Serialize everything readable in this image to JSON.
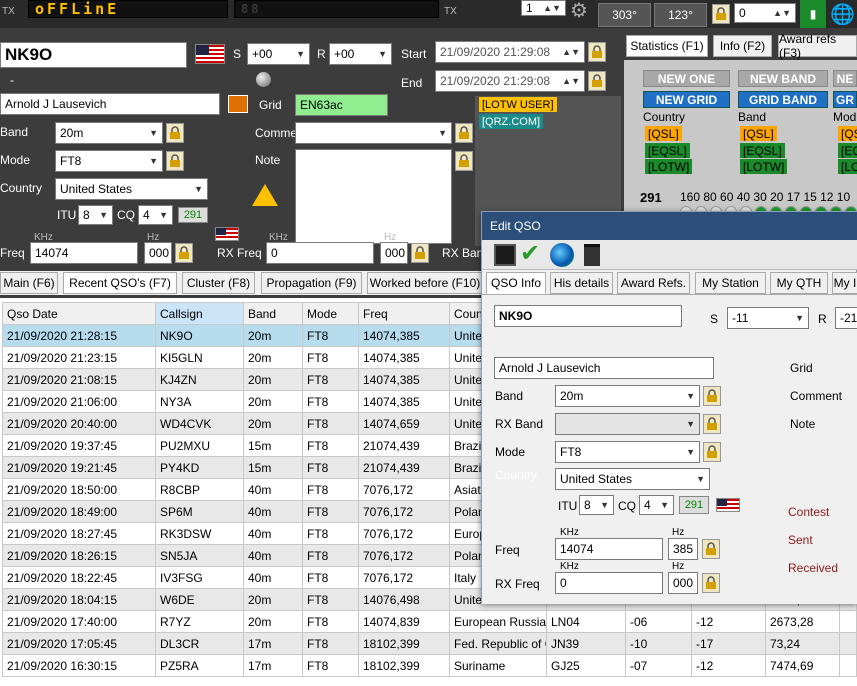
{
  "top": {
    "tx_label": "TX",
    "tx_label2": "TX",
    "lcd_dim": "88",
    "lcd_text": "oFFLinE",
    "spin_value": "1",
    "az_left": "303°",
    "az_right": "123°",
    "lock_input": "0"
  },
  "main": {
    "callsign": "NK9O",
    "s_label": "S",
    "s_value": "+00",
    "r_label": "R",
    "r_value": "+00",
    "start_label": "Start",
    "start_value": "21/09/2020 21:29:08",
    "end_label": "End",
    "end_value": "21/09/2020 21:29:08",
    "dash": "-",
    "name": "Arnold J Lausevich",
    "grid_label": "Grid",
    "grid_value": "EN63ac",
    "band_label": "Band",
    "band_value": "20m",
    "mode_label": "Mode",
    "mode_value": "FT8",
    "country_label": "Country",
    "country_value": "United States",
    "itu_label": "ITU",
    "itu_value": "8",
    "cq_label": "CQ",
    "cq_value": "4",
    "dxcc_value": "291",
    "comment_label": "Comment",
    "note_label": "Note",
    "lotw_user": "[LOTW USER]",
    "qrz": "[QRZ.COM]",
    "freq_label": "Freq",
    "khz": "KHz",
    "hz": "Hz",
    "freq_value": "14074",
    "hz_value": "000",
    "rx_freq_label": "RX Freq",
    "rx_freq_value": "0",
    "rx_hz_value": "000",
    "rx_band_label": "RX Ban"
  },
  "tabs": [
    "Main (F6)",
    "Recent QSO's (F7)",
    "Cluster (F8)",
    "Propagation (F9)",
    "Worked before (F10)"
  ],
  "table": {
    "headers": [
      "Qso Date",
      "Callsign",
      "Band",
      "Mode",
      "Freq",
      "Country"
    ],
    "rows": [
      [
        "21/09/2020 21:28:15",
        "NK9O",
        "20m",
        "FT8",
        "14074,385",
        "United States"
      ],
      [
        "21/09/2020 21:23:15",
        "KI5GLN",
        "20m",
        "FT8",
        "14074,385",
        "United States"
      ],
      [
        "21/09/2020 21:08:15",
        "KJ4ZN",
        "20m",
        "FT8",
        "14074,385",
        "United States"
      ],
      [
        "21/09/2020 21:06:00",
        "NY3A",
        "20m",
        "FT8",
        "14074,385",
        "United States"
      ],
      [
        "21/09/2020 20:40:00",
        "WD4CVK",
        "20m",
        "FT8",
        "14074,659",
        "United States"
      ],
      [
        "21/09/2020 19:37:45",
        "PU2MXU",
        "15m",
        "FT8",
        "21074,439",
        "Brazil"
      ],
      [
        "21/09/2020 19:21:45",
        "PY4KD",
        "15m",
        "FT8",
        "21074,439",
        "Brazil"
      ],
      [
        "21/09/2020 18:50:00",
        "R8CBP",
        "40m",
        "FT8",
        "7076,172",
        "Asiatic Russia"
      ],
      [
        "21/09/2020 18:49:00",
        "SP6M",
        "40m",
        "FT8",
        "7076,172",
        "Poland"
      ],
      [
        "21/09/2020 18:27:45",
        "RK3DSW",
        "40m",
        "FT8",
        "7076,172",
        "European Russia"
      ],
      [
        "21/09/2020 18:26:15",
        "SN5JA",
        "40m",
        "FT8",
        "7076,172",
        "Poland"
      ],
      [
        "21/09/2020 18:22:45",
        "IV3FSG",
        "40m",
        "FT8",
        "7076,172",
        "Italy"
      ],
      [
        "21/09/2020 18:04:15",
        "W6DE",
        "20m",
        "FT8",
        "14076,498",
        "United States"
      ],
      [
        "21/09/2020 17:40:00",
        "R7YZ",
        "20m",
        "FT8",
        "14074,839",
        "European Russia"
      ],
      [
        "21/09/2020 17:05:45",
        "DL3CR",
        "17m",
        "FT8",
        "18102,399",
        "Fed. Republic of Germany"
      ],
      [
        "21/09/2020 16:30:15",
        "PZ5RA",
        "17m",
        "FT8",
        "18102,399",
        "Suriname"
      ]
    ],
    "extra": [
      [
        "CM96",
        "-10",
        "-11",
        "8372,0"
      ],
      [
        "LN04",
        "-06",
        "-12",
        "2673,28"
      ],
      [
        "JN39",
        "-10",
        "-17",
        "73,24"
      ],
      [
        "GJ25",
        "-07",
        "-12",
        "7474,69"
      ]
    ]
  },
  "stats": {
    "tabs": [
      "Statistics (F1)",
      "Info (F2)",
      "Award refs (F3)"
    ],
    "new_one": "NEW ONE",
    "new_band": "NEW BAND",
    "new_grid": "NEW GRID",
    "grid_band": "GRID BAND",
    "gr": "GR",
    "ne": "NE",
    "country": "Country",
    "band": "Band",
    "mod": "Mod",
    "qsl": "[QSL]",
    "eqsl": "[EQSL]",
    "lotw": "[LOTW]",
    "count": "291",
    "bands": "160 80 60 40 30 20 17 15 12 10"
  },
  "dialog": {
    "title": "Edit QSO",
    "tabs": [
      "QSO Info",
      "His details",
      "Award Refs.",
      "My Station",
      "My QTH",
      "My I"
    ],
    "callsign": "NK9O",
    "s_label": "S",
    "s_value": "-11",
    "r_label": "R",
    "r_value": "-21",
    "name": "Arnold J Lausevich",
    "grid_label": "Grid",
    "band_label": "Band",
    "band_value": "20m",
    "comment_label": "Comment",
    "rx_band_label": "RX Band",
    "note_label": "Note",
    "mode_label": "Mode",
    "mode_value": "FT8",
    "country_label": "Country",
    "country_value": "United States",
    "itu_label": "ITU",
    "itu_value": "8",
    "cq_label": "CQ",
    "cq_value": "4",
    "dxcc_value": "291",
    "contest_label": "Contest",
    "sent_label": "Sent",
    "received_label": "Received",
    "freq_label": "Freq",
    "khz": "KHz",
    "hz": "Hz",
    "freq_value": "14074",
    "hz_value": "385",
    "rx_freq_label": "RX Freq",
    "rx_freq_value": "0",
    "rx_hz_value": "000"
  }
}
